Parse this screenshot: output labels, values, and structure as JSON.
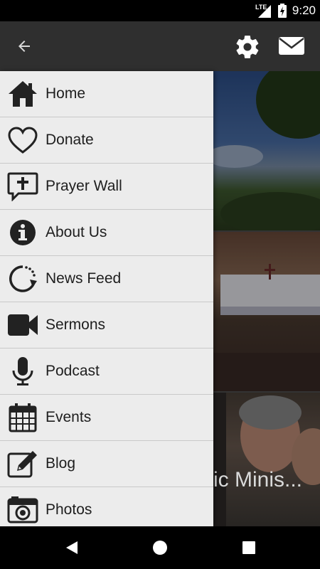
{
  "status_bar": {
    "network": "LTE",
    "time": "9:20"
  },
  "app_bar": {
    "back_icon": "arrow-back-icon",
    "settings_icon": "gear-icon",
    "mail_icon": "envelope-icon"
  },
  "drawer": {
    "items": [
      {
        "label": "Home",
        "icon": "home-icon"
      },
      {
        "label": "Donate",
        "icon": "heart-icon"
      },
      {
        "label": "Prayer Wall",
        "icon": "speech-bubble-cross-icon"
      },
      {
        "label": "About Us",
        "icon": "info-icon"
      },
      {
        "label": "News Feed",
        "icon": "refresh-feed-icon"
      },
      {
        "label": "Sermons",
        "icon": "video-camera-icon"
      },
      {
        "label": "Podcast",
        "icon": "microphone-icon"
      },
      {
        "label": "Events",
        "icon": "calendar-icon"
      },
      {
        "label": "Blog",
        "icon": "edit-icon"
      },
      {
        "label": "Photos",
        "icon": "camera-icon"
      }
    ]
  },
  "content": {
    "tile_caption": "ic Minis..."
  },
  "nav_bar": {
    "back": "triangle-back-icon",
    "home": "circle-home-icon",
    "recents": "square-recents-icon"
  },
  "colors": {
    "app_bar": "#2f2f2f",
    "drawer_bg": "#ececec",
    "divider": "#c9c9c9",
    "text": "#1e1e1e"
  }
}
